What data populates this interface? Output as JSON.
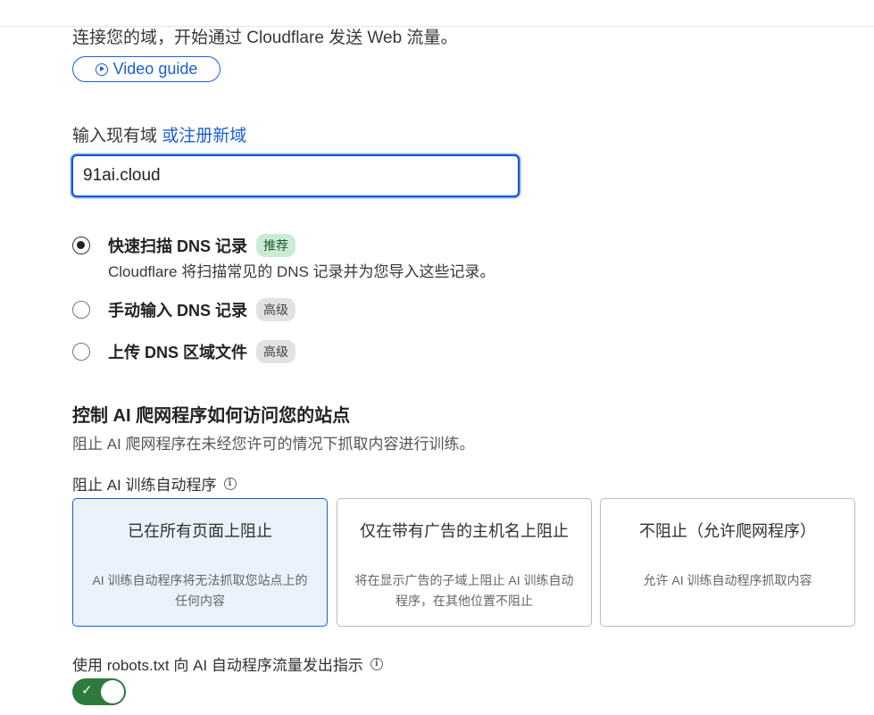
{
  "intro": {
    "text": "连接您的域，开始通过 Cloudflare 发送 Web 流量。"
  },
  "video_guide": {
    "label": "Video guide"
  },
  "domain": {
    "label": "输入现有域",
    "register_link": "或注册新域",
    "value": "91ai.cloud"
  },
  "dns_options": [
    {
      "label": "快速扫描 DNS 记录",
      "badge": "推荐",
      "checked": true,
      "description": "Cloudflare 将扫描常见的 DNS 记录并为您导入这些记录。"
    },
    {
      "label": "手动输入 DNS 记录",
      "badge": "高级",
      "checked": false
    },
    {
      "label": "上传 DNS 区域文件",
      "badge": "高级",
      "checked": false
    }
  ],
  "ai_section": {
    "title": "控制 AI 爬网程序如何访问您的站点",
    "description": "阻止 AI 爬网程序在未经您许可的情况下抓取内容进行训练。",
    "block_label": "阻止 AI 训练自动程序",
    "cards": [
      {
        "title": "已在所有页面上阻止",
        "description": "AI 训练自动程序将无法抓取您站点上的任何内容",
        "selected": true
      },
      {
        "title": "仅在带有广告的主机名上阻止",
        "description": "将在显示广告的子域上阻止 AI 训练自动程序，在其他位置不阻止",
        "selected": false
      },
      {
        "title": "不阻止（允许爬网程序）",
        "description": "允许 AI 训练自动程序抓取内容",
        "selected": false
      }
    ],
    "robots_label": "使用 robots.txt 向 AI 自动程序流量发出指示",
    "robots_enabled": true
  },
  "icons": {
    "info": "i",
    "check": "✓"
  }
}
